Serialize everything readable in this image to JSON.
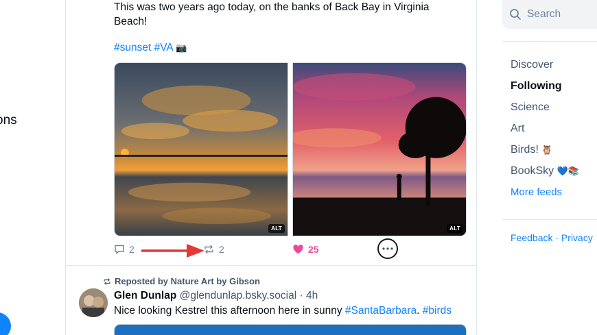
{
  "left_nav": {
    "partial_label": "ons"
  },
  "post1": {
    "text": "This was two years ago today, on the banks of Back Bay in Virginia Beach!",
    "tags": "#sunset #VA",
    "tag_emoji": "📷",
    "images": [
      {
        "alt_badge": "ALT",
        "icon": "sunset-cloud-reflection-photo"
      },
      {
        "alt_badge": "ALT",
        "icon": "sunset-tree-silhouette-photo"
      }
    ],
    "actions": {
      "reply_count": "2",
      "repost_count": "2",
      "like_count": "25"
    }
  },
  "post2": {
    "repost_label": "Reposted by Nature Art by Gibson",
    "author_name": "Glen Dunlap",
    "author_handle": "@glendunlap.bsky.social",
    "separator": "·",
    "time_ago": "4h",
    "text_plain": "Nice looking Kestrel this afternoon here in sunny",
    "link1": "#SantaBarbara",
    "link_sep": ".",
    "link2": "#birds"
  },
  "sidebar": {
    "search_placeholder": "Search",
    "feeds": [
      {
        "label": "Discover",
        "active": false
      },
      {
        "label": "Following",
        "active": true
      },
      {
        "label": "Science",
        "active": false
      },
      {
        "label": "Art",
        "active": false
      },
      {
        "label": "Birds!",
        "emoji": "🦉",
        "active": false
      },
      {
        "label": "BookSky",
        "emoji": "💙📚",
        "active": false
      }
    ],
    "more_feeds": "More feeds",
    "footer": {
      "feedback": "Feedback",
      "dot": "·",
      "privacy": "Privacy"
    }
  },
  "colors": {
    "accent": "#1083fe",
    "like": "#ec4899",
    "annotation_arrow": "#e53935",
    "muted": "#6f839f"
  }
}
